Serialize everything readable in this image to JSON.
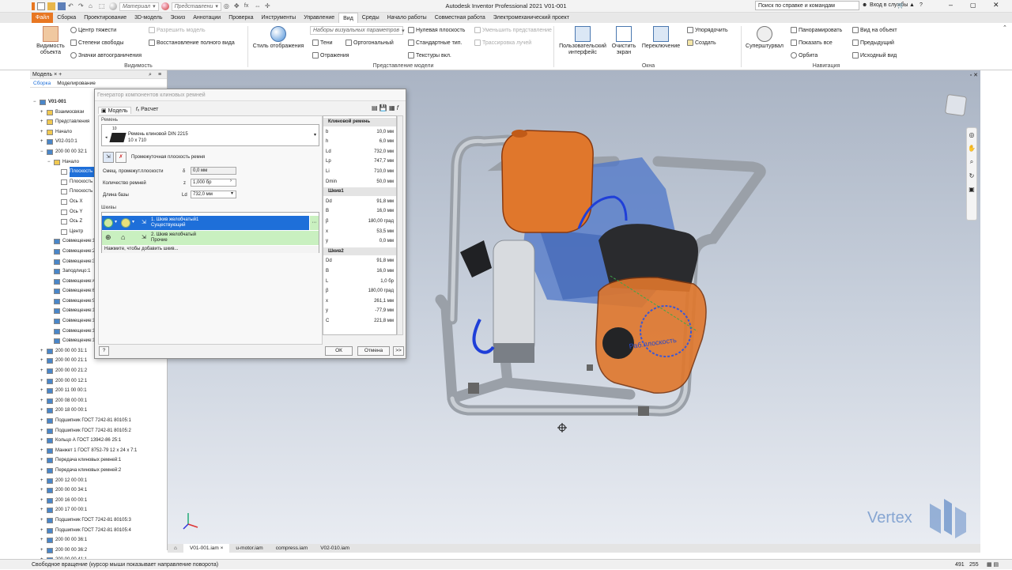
{
  "titlebar": {
    "material": "Материал",
    "appearance": "Представлени",
    "app_title": "Autodesk Inventor Professional 2021   V01-001",
    "search": "Поиск по справке и командам",
    "signin": "Вход в службы"
  },
  "tabs": [
    "Файл",
    "Сборка",
    "Проектирование",
    "3D-модель",
    "Эскиз",
    "Аннотации",
    "Проверка",
    "Инструменты",
    "Управление",
    "Вид",
    "Среды",
    "Начало работы",
    "Совместная работа",
    "Электромеханический проект"
  ],
  "ribbon": {
    "vis": {
      "obj": "Видимость объекта",
      "cog": "Центр тяжести",
      "dof": "Степени свободы",
      "autolim": "Значки автоограничения",
      "allowmod": "Разрешить модель",
      "restore": "Восстановление полного вида",
      "label": "Видимость"
    },
    "rep": {
      "style": "Стиль отображения",
      "visual": "Наборы визуальных параметров",
      "shadows": "Тени",
      "refl": "Отражения",
      "ortho": "Ортогональный",
      "ground": "Нулевая плоскость",
      "stdtypes": "Стандартные тип.",
      "textures": "Текстуры вкл.",
      "reduce": "Уменьшить представление",
      "trace": "Трассировка лучей",
      "label": "Представление модели"
    },
    "win": {
      "ui": "Пользовательский интерфейс",
      "clear": "Очистить экран",
      "switch": "Переключение",
      "arrange": "Упорядочить",
      "create": "Создать",
      "label": "Окна"
    },
    "nav": {
      "steering": "Суперштурвал",
      "pan": "Панорамировать",
      "zoomall": "Показать все",
      "orbit": "Орбита",
      "lookat": "Вид на объект",
      "prev": "Предыдущий",
      "home": "Исходный вид",
      "label": "Навигация"
    }
  },
  "browser": {
    "header": "Модель",
    "tab1": "Сборка",
    "tab2": "Моделирование",
    "nodes": [
      "V01-001",
      "Взаимосвязи",
      "Представления",
      "Начало",
      "V02-010:1",
      "200 00 00 32:1",
      "Начало",
      "Плоскость YZ",
      "Плоскость XZ",
      "Плоскость XY",
      "Ось X",
      "Ось Y",
      "Ось Z",
      "Центр",
      "Совмещение:1",
      "Совмещение:2",
      "Совмещение:3 (",
      "Заподлицо:1",
      "Совмещение:4",
      "Совмещение:6",
      "Совмещение:9",
      "Совмещение:10",
      "Совмещение:11",
      "Совмещение:12",
      "Совмещение:13",
      "200 00 00 31:1",
      "200 00 00 21:1",
      "200 00 00 21:2",
      "200 00 00 12:1",
      "200 11 00 00:1",
      "200 08 00 00:1",
      "200 18 00 00:1",
      "Подшипник ГОСТ 7242-81 80105:1",
      "Подшипник ГОСТ 7242-81 80105:2",
      "Кольцо А ГОСТ 13942-86 25:1",
      "Манжет 1 ГОСТ 8752-79 12 x 24 x 7:1",
      "Передача клиновых ремней:1",
      "Передача клиновых ремней:2",
      "200 12 00 00:1",
      "200 00 00 34:1",
      "200 16 00 00:1",
      "200 17 00 00:1",
      "Подшипник ГОСТ 7242-81 80105:3",
      "Подшипник ГОСТ 7242-81 80105:4",
      "200 00 00 36:1",
      "200 00 00 36:2",
      "200 00 00 41:1"
    ]
  },
  "dialog": {
    "title": "Генератор компонентов клиновых ремней",
    "tab_model": "Модель",
    "tab_calc": "Расчет",
    "belt_section": "Ремень",
    "belt_name": "Ремень клиновой DIN 2215",
    "belt_size": "10 x 710",
    "belt_num": "10",
    "midplane": "Промежуточная плоскость ремня",
    "offset_lbl": "Смещ. промежут.плоскости",
    "offset_sym": "δ",
    "offset_val": "0,0 мм",
    "count_lbl": "Количество ремней",
    "count_sym": "z",
    "count_val": "1,000 бр",
    "len_lbl": "Длина базы",
    "len_sym": "Ld",
    "len_val": "732,0 мм",
    "sheaves_section": "Шкивы",
    "sheave1a": "1. Шкив желобчатый1",
    "sheave1b": "Существующий",
    "sheave2a": "2. Шкив желобчатый",
    "sheave2b": "Прочие",
    "add_sheave": "Нажмите, чтобы добавить шкив...",
    "ok": "ОК",
    "cancel": "Отмена",
    "more": ">>"
  },
  "results": {
    "rows": [
      {
        "k": "Клиновой ремень",
        "v": "",
        "h": true
      },
      {
        "k": "b",
        "v": "10,0 мм"
      },
      {
        "k": "h",
        "v": "6,0 мм"
      },
      {
        "k": "Ld",
        "v": "732,0 мм"
      },
      {
        "k": "Lp",
        "v": "747,7 мм"
      },
      {
        "k": "Li",
        "v": "710,0 мм"
      },
      {
        "k": "Dmin",
        "v": "50,0 мм"
      },
      {
        "k": "Шкив1",
        "v": "",
        "h": true
      },
      {
        "k": "Dd",
        "v": "91,8 мм"
      },
      {
        "k": "B",
        "v": "16,0 мм"
      },
      {
        "k": "β",
        "v": "180,00 град"
      },
      {
        "k": "x",
        "v": "53,5 мм"
      },
      {
        "k": "y",
        "v": "0,0 мм"
      },
      {
        "k": "Шкив2",
        "v": "",
        "h": true
      },
      {
        "k": "Dd",
        "v": "91,8 мм"
      },
      {
        "k": "B",
        "v": "16,0 мм"
      },
      {
        "k": "L",
        "v": "1,0 бр"
      },
      {
        "k": "β",
        "v": "180,00 град"
      },
      {
        "k": "x",
        "v": "261,1 мм"
      },
      {
        "k": "y",
        "v": "-77,9 мм"
      },
      {
        "k": "C",
        "v": "221,8 мм"
      }
    ]
  },
  "viewport": {
    "sketch_label": "Раб.плоскость",
    "brand": "Vertex"
  },
  "doctabs": [
    "V01-001.iam",
    "u-motor.iam",
    "compress.iam",
    "V02-010.iam"
  ],
  "status": {
    "text": "Свободное вращение (курсор мыши показывает направление поворота)",
    "n1": "491",
    "n2": "255"
  },
  "colors": {
    "file_tab": "#e87722",
    "selection": "#1e6fd9",
    "green_row": "#c9f0c0"
  }
}
